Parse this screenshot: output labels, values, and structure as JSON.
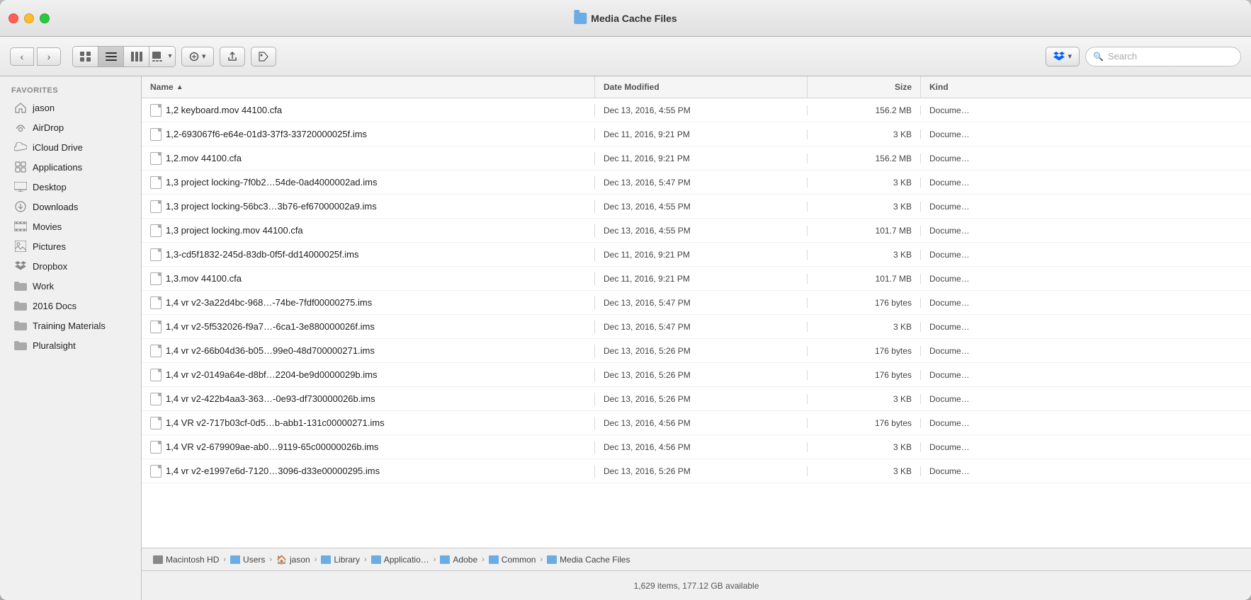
{
  "window": {
    "title": "Media Cache Files"
  },
  "toolbar": {
    "search_placeholder": "Search"
  },
  "sidebar": {
    "section_label": "Favorites",
    "items": [
      {
        "id": "jason",
        "label": "jason",
        "icon": "home"
      },
      {
        "id": "airdrop",
        "label": "AirDrop",
        "icon": "airdrop"
      },
      {
        "id": "icloud",
        "label": "iCloud Drive",
        "icon": "cloud"
      },
      {
        "id": "applications",
        "label": "Applications",
        "icon": "applications"
      },
      {
        "id": "desktop",
        "label": "Desktop",
        "icon": "desktop"
      },
      {
        "id": "downloads",
        "label": "Downloads",
        "icon": "downloads"
      },
      {
        "id": "movies",
        "label": "Movies",
        "icon": "movies"
      },
      {
        "id": "pictures",
        "label": "Pictures",
        "icon": "pictures"
      },
      {
        "id": "dropbox",
        "label": "Dropbox",
        "icon": "dropbox"
      },
      {
        "id": "work",
        "label": "Work",
        "icon": "folder"
      },
      {
        "id": "2016docs",
        "label": "2016 Docs",
        "icon": "folder"
      },
      {
        "id": "training",
        "label": "Training Materials",
        "icon": "folder"
      },
      {
        "id": "pluralsight",
        "label": "Pluralsight",
        "icon": "folder"
      }
    ]
  },
  "file_list": {
    "columns": {
      "name": "Name",
      "date": "Date Modified",
      "size": "Size",
      "kind": "Kind"
    },
    "files": [
      {
        "name": "1,2 keyboard.mov 44100.cfa",
        "date": "Dec 13, 2016, 4:55 PM",
        "size": "156.2 MB",
        "kind": "Docume…"
      },
      {
        "name": "1,2-693067f6-e64e-01d3-37f3-33720000025f.ims",
        "date": "Dec 11, 2016, 9:21 PM",
        "size": "3 KB",
        "kind": "Docume…"
      },
      {
        "name": "1,2.mov 44100.cfa",
        "date": "Dec 11, 2016, 9:21 PM",
        "size": "156.2 MB",
        "kind": "Docume…"
      },
      {
        "name": "1,3 project locking-7f0b2…54de-0ad4000002ad.ims",
        "date": "Dec 13, 2016, 5:47 PM",
        "size": "3 KB",
        "kind": "Docume…"
      },
      {
        "name": "1,3 project locking-56bc3…3b76-ef67000002a9.ims",
        "date": "Dec 13, 2016, 4:55 PM",
        "size": "3 KB",
        "kind": "Docume…"
      },
      {
        "name": "1,3 project locking.mov 44100.cfa",
        "date": "Dec 13, 2016, 4:55 PM",
        "size": "101.7 MB",
        "kind": "Docume…"
      },
      {
        "name": "1,3-cd5f1832-245d-83db-0f5f-dd14000025f.ims",
        "date": "Dec 11, 2016, 9:21 PM",
        "size": "3 KB",
        "kind": "Docume…"
      },
      {
        "name": "1,3.mov 44100.cfa",
        "date": "Dec 11, 2016, 9:21 PM",
        "size": "101.7 MB",
        "kind": "Docume…"
      },
      {
        "name": "1,4 vr v2-3a22d4bc-968…-74be-7fdf00000275.ims",
        "date": "Dec 13, 2016, 5:47 PM",
        "size": "176 bytes",
        "kind": "Docume…"
      },
      {
        "name": "1,4 vr v2-5f532026-f9a7…-6ca1-3e880000026f.ims",
        "date": "Dec 13, 2016, 5:47 PM",
        "size": "3 KB",
        "kind": "Docume…"
      },
      {
        "name": "1,4 vr v2-66b04d36-b05…99e0-48d700000271.ims",
        "date": "Dec 13, 2016, 5:26 PM",
        "size": "176 bytes",
        "kind": "Docume…"
      },
      {
        "name": "1,4 vr v2-0149a64e-d8bf…2204-be9d0000029b.ims",
        "date": "Dec 13, 2016, 5:26 PM",
        "size": "176 bytes",
        "kind": "Docume…"
      },
      {
        "name": "1,4 vr v2-422b4aa3-363…-0e93-df730000026b.ims",
        "date": "Dec 13, 2016, 5:26 PM",
        "size": "3 KB",
        "kind": "Docume…"
      },
      {
        "name": "1,4 VR v2-717b03cf-0d5…b-abb1-131c00000271.ims",
        "date": "Dec 13, 2016, 4:56 PM",
        "size": "176 bytes",
        "kind": "Docume…"
      },
      {
        "name": "1,4 VR v2-679909ae-ab0…9119-65c00000026b.ims",
        "date": "Dec 13, 2016, 4:56 PM",
        "size": "3 KB",
        "kind": "Docume…"
      },
      {
        "name": "1,4 vr v2-e1997e6d-7120…3096-d33e00000295.ims",
        "date": "Dec 13, 2016, 5:26 PM",
        "size": "3 KB",
        "kind": "Docume…"
      }
    ]
  },
  "breadcrumb": {
    "items": [
      {
        "label": "Macintosh HD",
        "type": "hd"
      },
      {
        "label": "Users",
        "type": "folder"
      },
      {
        "label": "jason",
        "type": "home"
      },
      {
        "label": "Library",
        "type": "folder"
      },
      {
        "label": "Applicatio…",
        "type": "folder"
      },
      {
        "label": "Adobe",
        "type": "folder"
      },
      {
        "label": "Common",
        "type": "folder"
      },
      {
        "label": "Media Cache Files",
        "type": "folder"
      }
    ]
  },
  "statusbar": {
    "text": "1,629 items, 177.12 GB available"
  }
}
